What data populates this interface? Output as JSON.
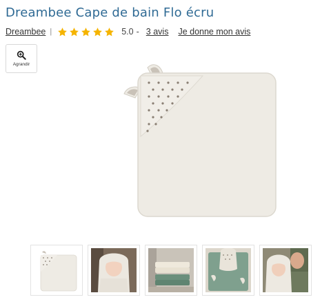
{
  "product": {
    "title": "Dreambee Cape de bain Flo écru",
    "brand": "Dreambee",
    "separator": "|",
    "rating": {
      "score": "5.0",
      "stars_filled": 5,
      "stars_total": 5,
      "dash": "-",
      "reviews_link": "3 avis",
      "write_review_link": "Je donne mon avis"
    }
  },
  "gallery": {
    "zoom_label": "Agrandir",
    "thumbnail_count": 5
  },
  "colors": {
    "title": "#2f6a94",
    "star": "#f5b400",
    "towel": "#eeebe4",
    "towel_shadow": "#dcd8cf",
    "dots": "#8a7f73",
    "ear_inner": "#c9c2b8"
  }
}
